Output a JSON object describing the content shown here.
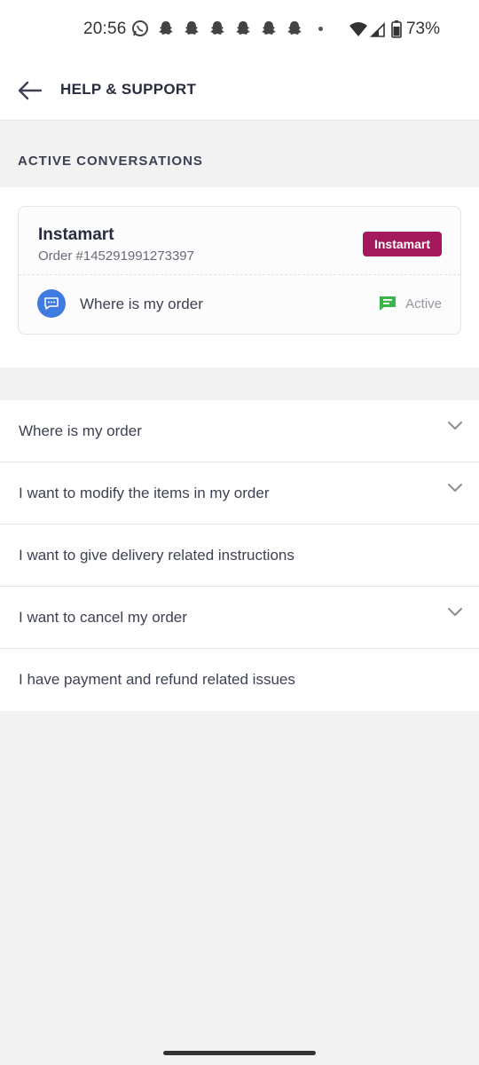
{
  "status_bar": {
    "time": "20:56",
    "battery": "73%",
    "icons": [
      "whatsapp-icon",
      "snapchat-icon",
      "snapchat-icon",
      "snapchat-icon",
      "snapchat-icon",
      "snapchat-icon",
      "snapchat-icon",
      "wifi-icon",
      "signal-icon",
      "battery-icon"
    ]
  },
  "header": {
    "title": "HELP & SUPPORT"
  },
  "active_section": {
    "heading": "ACTIVE CONVERSATIONS",
    "card": {
      "brand": "Instamart",
      "order": "Order #145291991273397",
      "badge": "Instamart",
      "topic": "Where is my order",
      "status": "Active"
    }
  },
  "faq": [
    {
      "label": "Where is my order",
      "expandable": true
    },
    {
      "label": "I want to modify the items in my order",
      "expandable": true
    },
    {
      "label": "I want to give delivery related instructions",
      "expandable": false
    },
    {
      "label": "I want to cancel my order",
      "expandable": true
    },
    {
      "label": "I have payment and refund related issues",
      "expandable": false
    }
  ],
  "colors": {
    "badge": "#a3195b",
    "chat_bubble": "#3f7ae0",
    "active_green": "#3bb54a",
    "background": "#f2f2f3"
  }
}
